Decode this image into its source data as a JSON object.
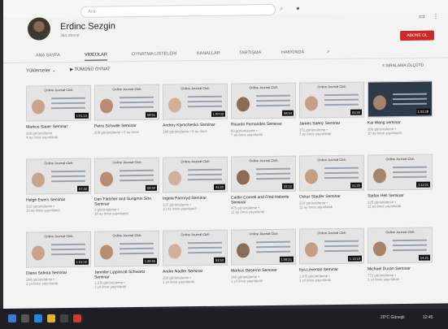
{
  "search": {
    "placeholder": "Ara"
  },
  "channel": {
    "name": "Erdinc Sezgin",
    "subs": "364 abone",
    "subscribe_label": "ABONE OL"
  },
  "tabs": [
    {
      "label": "ANA SAYFA"
    },
    {
      "label": "VİDEOLAR"
    },
    {
      "label": "OYNATMA LİSTELERİ"
    },
    {
      "label": "KANALLAR"
    },
    {
      "label": "TARTIŞMA"
    },
    {
      "label": "HAKKINDA"
    }
  ],
  "sort": {
    "left": "Yüklemeler",
    "mid": "TÜMÜNÜ OYNAT",
    "right": "SIRALAMA ÖLÇÜTÜ"
  },
  "videos": [
    {
      "title": "Markus Sauer Seminar",
      "views": "208 görüntüleme",
      "age": "4 ay önce yayınlandı",
      "dur": "1:01:15",
      "hdr": "Online Journal Club"
    },
    {
      "title": "Petra Schwille Seminar",
      "views": "209 görüntüleme • 5 ay önce",
      "age": "",
      "dur": "58:51",
      "hdr": "Online Journal Club"
    },
    {
      "title": "Andrey Klymchenko Seminar",
      "views": "148 görüntüleme • 6 ay önce",
      "age": "",
      "dur": "1:00:02",
      "hdr": "Online Journal Club"
    },
    {
      "title": "Ricardo Fernandes Seminar",
      "views": "83 görüntüleme •",
      "age": "7 ay önce yayınlandı",
      "dur": "58:54",
      "hdr": "Online Journal Club"
    },
    {
      "title": "James Saenz Seminar",
      "views": "372 görüntüleme •",
      "age": "7 ay önce yayınlandı",
      "dur": "55:56",
      "hdr": "Online Journal Club"
    },
    {
      "title": "Kai Wang seminar",
      "views": "286 görüntüleme •",
      "age": "10 ay önce yayınlandı",
      "dur": "1:02:28",
      "hdr": ""
    },
    {
      "title": "Helge Ewers Seminar",
      "views": "322 görüntüleme •",
      "age": "10 ay önce yayınlandı",
      "dur": "57:32",
      "hdr": "Online Journal Club"
    },
    {
      "title": "Dan Fletcher and Sungmin Son Seminar",
      "views": "1 görüntüleme •",
      "age": "10 ay önce yayınlandı",
      "dur": "58:49",
      "hdr": "Online Journal Club"
    },
    {
      "title": "Ingela Parmryd Seminar",
      "views": "137 görüntüleme •",
      "age": "10 ay önce yayınlandı",
      "dur": "41:20",
      "hdr": "Online Journal Club"
    },
    {
      "title": "Caitlin Cornell and Fred Heberle Seminar",
      "views": "475 görüntüleme •",
      "age": "11 ay önce yayınlandı",
      "dur": "22:12",
      "hdr": "Online Journal Club"
    },
    {
      "title": "Oskar Staufer Seminar",
      "views": "229 görüntüleme •",
      "age": "11 ay önce yayınlandı",
      "dur": "51:25",
      "hdr": "Online Journal Club"
    },
    {
      "title": "Stefan Hell Seminar",
      "views": "225 görüntüleme •",
      "age": "11 ay önce yayınlandı",
      "dur": "1:11:51",
      "hdr": "Online Journal Club"
    },
    {
      "title": "Diana Sobota Seminar",
      "views": "240 görüntüleme •",
      "age": "1 yıl önce yayınlandı",
      "dur": "1:01:02",
      "hdr": "Online Journal Club"
    },
    {
      "title": "Jennifer Lippincott Schwartz Seminar",
      "views": "1,2 B görüntüleme •",
      "age": "1 yıl önce yayınlandı",
      "dur": "1:28:45",
      "hdr": "Online Journal Club"
    },
    {
      "title": "Andre Nadler Seminar",
      "views": "250 görüntüleme •",
      "age": "1 yıl önce yayınlandı",
      "dur": "52:50",
      "hdr": "Online Journal Club"
    },
    {
      "title": "Markus Deserno Seminar",
      "views": "348 görüntüleme •",
      "age": "1 yıl önce yayınlandı",
      "dur": "1:08:21",
      "hdr": "Online Journal Club"
    },
    {
      "title": "Ilya Levental Seminar",
      "views": "1,6 B görüntüleme •",
      "age": "1 yıl önce yayınlandı",
      "dur": "1:13:16",
      "hdr": "Online Journal Club"
    },
    {
      "title": "Michael Dustin Seminar",
      "views": "772 görüntüleme •",
      "age": "1 yıl önce yayınlandı",
      "dur": "54:21",
      "hdr": "Online Journal Club"
    }
  ],
  "taskbar": {
    "weather": "20°C Güneşli",
    "time": "12:45"
  },
  "colors": {
    "accent": "#cc2a2a"
  }
}
